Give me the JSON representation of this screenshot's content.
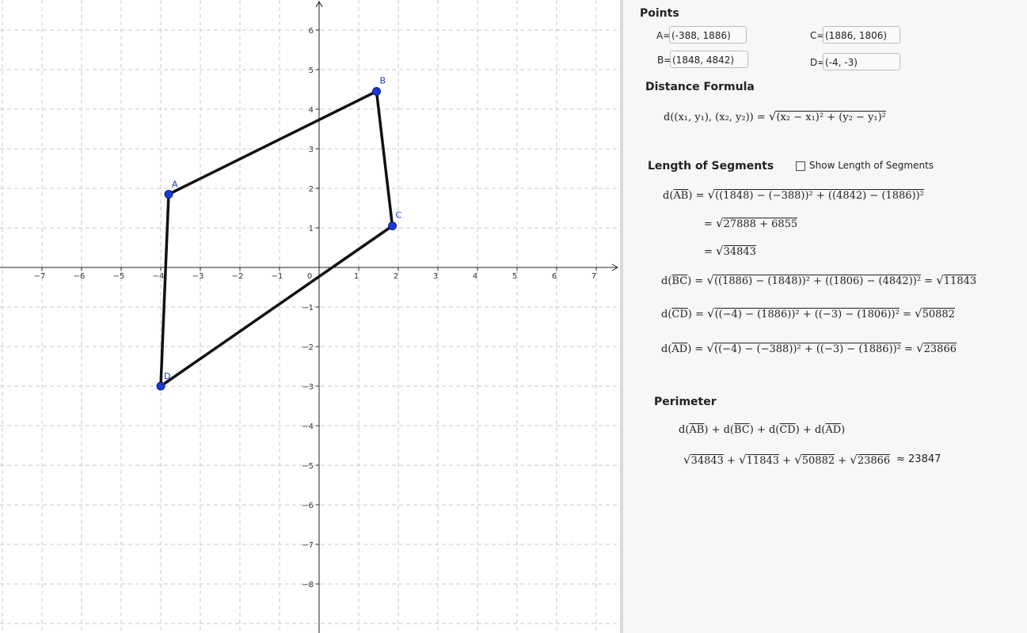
{
  "graphics": {
    "x_ticks": [
      "−7",
      "−6",
      "−5",
      "−4",
      "−3",
      "−2",
      "−1",
      "0",
      "1",
      "2",
      "3",
      "4",
      "5",
      "6",
      "7"
    ],
    "y_ticks_pos": [
      "1",
      "2",
      "3",
      "4",
      "5",
      "6"
    ],
    "y_ticks_neg": [
      "−1",
      "−2",
      "−3",
      "−4",
      "−5",
      "−6",
      "−7",
      "−8"
    ],
    "points": [
      {
        "name": "A",
        "x": -3.8,
        "y": 1.85
      },
      {
        "name": "B",
        "x": 1.45,
        "y": 4.45
      },
      {
        "name": "C",
        "x": 1.85,
        "y": 1.05
      },
      {
        "name": "D",
        "x": -4.0,
        "y": -3.0
      }
    ],
    "point_color": "#1a3ad6",
    "segment_color": "#111111"
  },
  "panel": {
    "points_heading": "Points",
    "A_label": "A=",
    "A_value": "(-388, 1886)",
    "B_label": "B=",
    "B_value": "(1848, 4842)",
    "C_label": "C=",
    "C_value": "(1886, 1806)",
    "D_label": "D=",
    "D_value": "(-4, -3)",
    "distance_heading": "Distance Formula",
    "length_heading": "Length of Segments",
    "show_length_label": "Show Length of Segments",
    "show_length_checked": false,
    "perimeter_heading": "Perimeter",
    "formula": {
      "dist_lhs": "d((x₁, y₁), (x₂, y₂)) = ",
      "dist_rad": "(x₂ − x₁)² + (y₂ − y₁)²"
    },
    "ab": {
      "lhs_pre": "d(",
      "seg": "AB",
      "lhs_post": ") = ",
      "rad1": "((1848) − (−388))² + ((4842) − (1886))²",
      "step2_eq": "= ",
      "rad2": "27888 + 6855",
      "step3_eq": "= ",
      "rad3": "34843"
    },
    "bc": {
      "lhs_pre": "d(",
      "seg": "BC",
      "lhs_post": ") = ",
      "rad1": "((1886) − (1848))² + ((1806) − (4842))²",
      "eq": " = ",
      "rad2": "11843"
    },
    "cd": {
      "lhs_pre": "d(",
      "seg": "CD",
      "lhs_post": ") = ",
      "rad1": "((−4) − (1886))² + ((−3) − (1806))²",
      "eq": " = ",
      "rad2": "50882"
    },
    "ad": {
      "lhs_pre": "d(",
      "seg": "AD",
      "lhs_post": ") = ",
      "rad1": "((−4) − (−388))² + ((−3) − (1886))²",
      "eq": " = ",
      "rad2": "23866"
    },
    "perimeter": {
      "d1": "d(",
      "s1": "AB",
      "p1": ") + d(",
      "s2": "BC",
      "p2": ") + d(",
      "s3": "CD",
      "p3": ") + d(",
      "s4": "AD",
      "p4": ")",
      "r1": "34843",
      "plus1": " + ",
      "r2": "11843",
      "plus2": " + ",
      "r3": "50882",
      "plus3": " + ",
      "r4": "23866",
      "approx": "≈ 23847"
    }
  }
}
